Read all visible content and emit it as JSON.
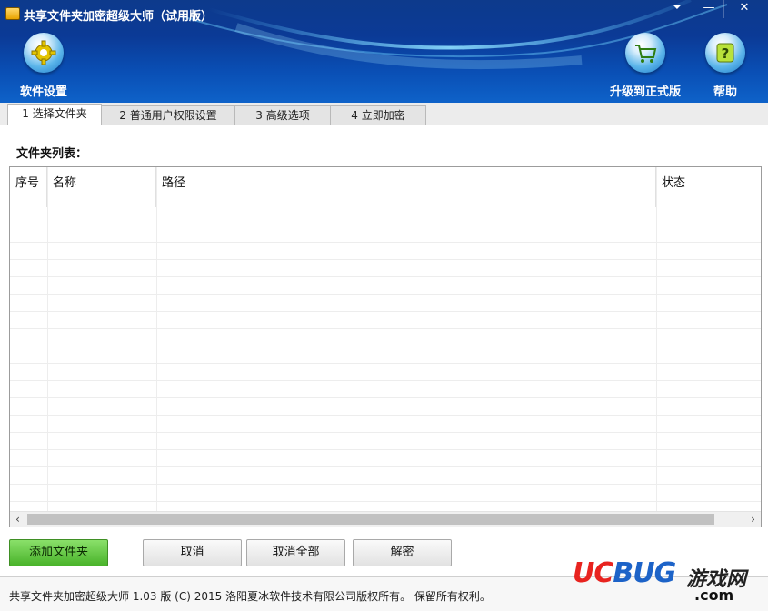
{
  "window": {
    "title": "共享文件夹加密超级大师（试用版）",
    "controls": {
      "menu": "⏷",
      "minimize": "—",
      "close": "✕"
    }
  },
  "toolbar": {
    "settings_label": "软件设置",
    "upgrade_label": "升级到正式版",
    "help_label": "帮助"
  },
  "tabs": [
    {
      "label": "1 选择文件夹",
      "active": true
    },
    {
      "label": "2 普通用户权限设置",
      "active": false
    },
    {
      "label": "3 高级选项",
      "active": false
    },
    {
      "label": "4 立即加密",
      "active": false
    }
  ],
  "folder_list": {
    "label": "文件夹列表：",
    "columns": [
      "序号",
      "名称",
      "路径",
      "状态"
    ],
    "rows": []
  },
  "buttons": {
    "add_folder": "添加文件夹",
    "cancel": "取消",
    "cancel_all": "取消全部",
    "decrypt": "解密"
  },
  "footer": {
    "copyright": "共享文件夹加密超级大师 1.03 版 (C) 2015 洛阳夏冰软件技术有限公司版权所有。 保留所有权利。"
  },
  "watermark": {
    "brand_uc": "UC",
    "brand_bug": "BUG",
    "cn": "游戏网",
    "domain": ".com"
  },
  "colors": {
    "header_blue": "#0b3a96",
    "primary_green": "#49b32a",
    "watermark_red": "#e8231f"
  }
}
